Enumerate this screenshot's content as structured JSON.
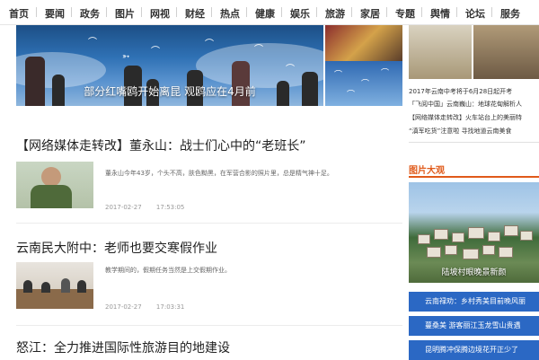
{
  "nav": {
    "items": [
      "首页",
      "要闻",
      "政务",
      "图片",
      "网视",
      "财经",
      "热点",
      "健康",
      "娱乐",
      "旅游",
      "家居",
      "专题",
      "舆情",
      "论坛",
      "服务"
    ]
  },
  "hero": {
    "caption": "部分红嘴鸥开始离昆 观鸥应在4月前"
  },
  "articles": [
    {
      "title": "【网络媒体走转改】董永山：战士们心中的“老班长”",
      "snippet": "董永山今年43岁，个头不高，肤色黝黑，在军营合影的照片里，总是精气神十足。",
      "date": "2017-02-27",
      "time": "17:53:05"
    },
    {
      "title": "云南民大附中：老师也要交寒假作业",
      "snippet": "教学期间的，假期任务当然是上交假期作业。",
      "date": "2017-02-27",
      "time": "17:03:31"
    },
    {
      "title": "怒江：全力推进国际性旅游目的地建设"
    }
  ],
  "right": {
    "links": [
      "2017年云南中考将于6月28日起开考",
      "「飞阅中国」云南巍山：地球花甸解析人",
      "【网络媒体走转改】火车站台上的美丽特",
      "“滇军吃货”注意啦 寻找地道云南美食"
    ],
    "section_title": "图片大观",
    "photo_caption": "陆坡村眼晚景新颜",
    "bars": [
      "云南禄劝：乡村秀美目前晚风丽",
      "蔓桑美 游客丽江玉龙雪山贵遇",
      "昆明腾冲保腾边境花开正少了"
    ]
  }
}
